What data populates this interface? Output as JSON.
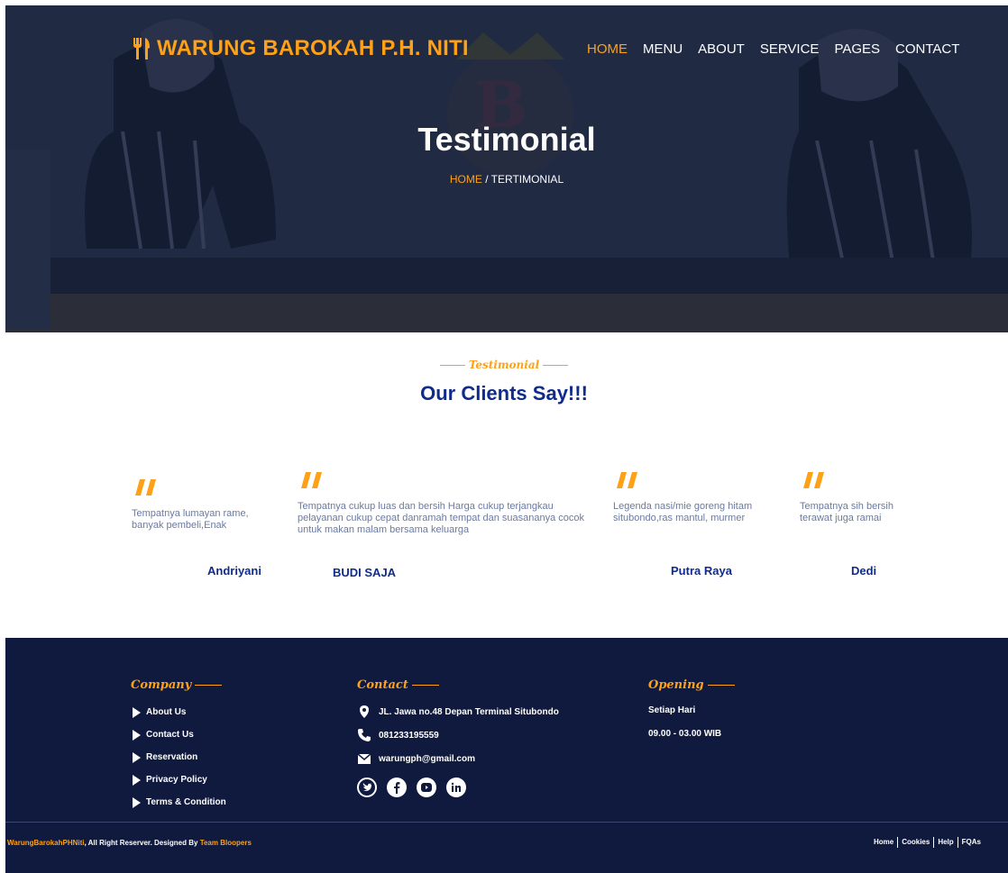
{
  "header": {
    "brand": "WARUNG BAROKAH P.H. NITI",
    "nav": [
      "HOME",
      "MENU",
      "ABOUT",
      "SERVICE",
      "PAGES",
      "CONTACT"
    ],
    "active_nav": "HOME"
  },
  "hero": {
    "title": "Testimonial",
    "breadcrumb_home": "HOME",
    "breadcrumb_separator": " / ",
    "breadcrumb_current": "TERTIMONIAL"
  },
  "testimonials_section": {
    "label": "Testimonial",
    "heading": "Our Clients Say!!!",
    "items": [
      {
        "text": "Tempatnya lumayan rame, banyak pembeli,Enak",
        "name": "Andriyani"
      },
      {
        "text": "Tempatnya cukup luas dan bersih Harga cukup terjangkau pelayanan cukup cepat danramah tempat dan suasananya cocok untuk makan malam bersama keluarga",
        "name": "BUDI SAJA"
      },
      {
        "text": "Legenda nasi/mie goreng hitam situbondo,ras mantul, murmer",
        "name": "Putra Raya"
      },
      {
        "text": "Tempatnya sih bersih terawat juga ramai",
        "name": "Dedi"
      }
    ]
  },
  "footer": {
    "company": {
      "heading": "Company",
      "links": [
        "About Us",
        "Contact Us",
        "Reservation",
        "Privacy Policy",
        "Terms & Condition"
      ]
    },
    "contact": {
      "heading": "Contact",
      "address": "JL. Jawa no.48 Depan Terminal Situbondo",
      "phone": "081233195559",
      "email": "warungph@gmail.com",
      "socials": [
        "twitter-icon",
        "facebook-icon",
        "youtube-icon",
        "linkedin-icon"
      ]
    },
    "opening": {
      "heading": "Opening",
      "days": "Setiap Hari",
      "hours": "09.00 - 03.00 WIB"
    },
    "copyright_brand": "WarungBarokahPHNiti",
    "copyright_text": ", All Right Reserver. Designed By ",
    "copyright_team": "Team Bloopers",
    "bottom_links": [
      "Home",
      "Cookies",
      "Help",
      "FQAs"
    ]
  },
  "colors": {
    "accent": "#fea116",
    "primary": "#0f2b8c",
    "footer_bg": "#0f1a3e"
  }
}
